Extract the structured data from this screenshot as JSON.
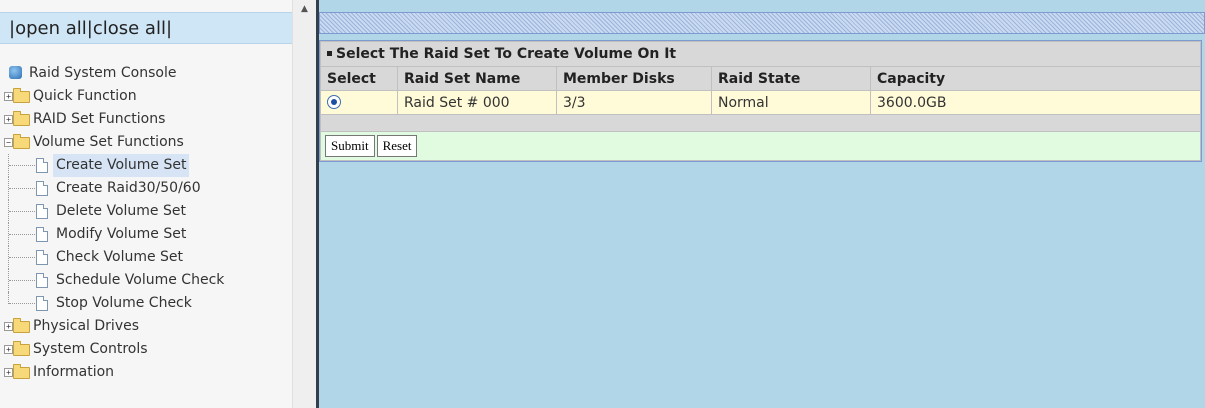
{
  "nav": {
    "open_all": "open all",
    "close_all": "close all",
    "sep": "|",
    "root_label": "Raid System Console",
    "tree": [
      {
        "label": "Quick Function",
        "type": "folder",
        "level": 0,
        "expanded": false
      },
      {
        "label": "RAID Set Functions",
        "type": "folder",
        "level": 0,
        "expanded": false
      },
      {
        "label": "Volume Set Functions",
        "type": "folder",
        "level": 0,
        "expanded": true
      },
      {
        "label": "Create Volume Set",
        "type": "doc",
        "level": 1,
        "selected": true
      },
      {
        "label": "Create Raid30/50/60",
        "type": "doc",
        "level": 1
      },
      {
        "label": "Delete Volume Set",
        "type": "doc",
        "level": 1
      },
      {
        "label": "Modify Volume Set",
        "type": "doc",
        "level": 1
      },
      {
        "label": "Check Volume Set",
        "type": "doc",
        "level": 1
      },
      {
        "label": "Schedule Volume Check",
        "type": "doc",
        "level": 1
      },
      {
        "label": "Stop Volume Check",
        "type": "doc",
        "level": 1
      },
      {
        "label": "Physical Drives",
        "type": "folder",
        "level": 0,
        "expanded": false
      },
      {
        "label": "System Controls",
        "type": "folder",
        "level": 0,
        "expanded": false
      },
      {
        "label": "Information",
        "type": "folder",
        "level": 0,
        "expanded": false
      }
    ]
  },
  "main": {
    "title": "Select The Raid Set To Create Volume On It",
    "columns": [
      "Select",
      "Raid Set Name",
      "Member Disks",
      "Raid State",
      "Capacity"
    ],
    "rows": [
      {
        "selected": true,
        "name": "Raid Set # 000",
        "member_disks": "3/3",
        "state": "Normal",
        "capacity": "3600.0GB"
      }
    ],
    "submit_label": "Submit",
    "reset_label": "Reset"
  },
  "colors": {
    "content_bg": "#b0d6e8",
    "row_bg": "#fffbd8",
    "actions_bg": "#e1fbe0",
    "header_bg": "#d8d8d8"
  }
}
